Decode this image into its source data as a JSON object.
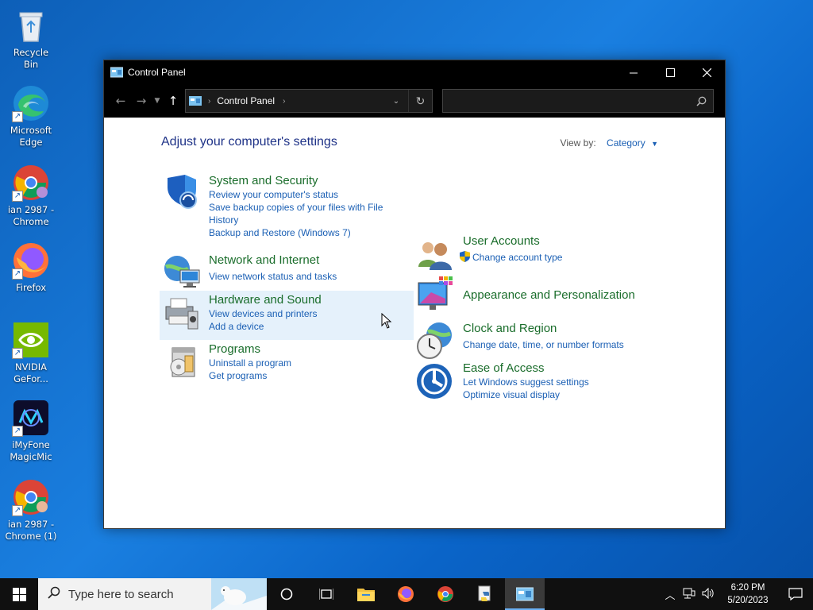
{
  "desktop": {
    "icons": [
      {
        "label": "Recycle Bin",
        "icon": "recycle-bin-icon"
      },
      {
        "label": "Microsoft Edge",
        "icon": "edge-icon"
      },
      {
        "label": "ian 2987 - Chrome",
        "icon": "chrome-icon"
      },
      {
        "label": "Firefox",
        "icon": "firefox-icon"
      },
      {
        "label": "NVIDIA GeFor...",
        "icon": "nvidia-icon"
      },
      {
        "label": "iMyFone MagicMic",
        "icon": "magicmic-icon"
      },
      {
        "label": "ian 2987 - Chrome (1)",
        "icon": "chrome-icon"
      }
    ]
  },
  "window": {
    "title": "Control Panel",
    "address": {
      "crumb": "Control Panel"
    },
    "search": {
      "placeholder": ""
    },
    "heading": "Adjust your computer's settings",
    "view_by": {
      "label": "View by:",
      "value": "Category"
    },
    "categories": [
      {
        "title": "System and Security",
        "links": [
          "Review your computer's status",
          "Save backup copies of your files with File History",
          "Backup and Restore (Windows 7)"
        ]
      },
      {
        "title": "Network and Internet",
        "links": [
          "View network status and tasks"
        ]
      },
      {
        "title": "Hardware and Sound",
        "links": [
          "View devices and printers",
          "Add a device"
        ]
      },
      {
        "title": "Programs",
        "links": [
          "Uninstall a program",
          "Get programs"
        ]
      },
      {
        "title": "User Accounts",
        "links": [
          "Change account type"
        ]
      },
      {
        "title": "Appearance and Personalization",
        "links": []
      },
      {
        "title": "Clock and Region",
        "links": [
          "Change date, time, or number formats"
        ]
      },
      {
        "title": "Ease of Access",
        "links": [
          "Let Windows suggest settings",
          "Optimize visual display"
        ]
      }
    ]
  },
  "taskbar": {
    "search_placeholder": "Type here to search",
    "time": "6:20 PM",
    "date": "5/20/2023"
  },
  "colors": {
    "accent": "#1a5fb4",
    "category_green": "#1a6d2b",
    "heading_blue": "#1e3287",
    "hover_bg": "#e5f1fb"
  }
}
